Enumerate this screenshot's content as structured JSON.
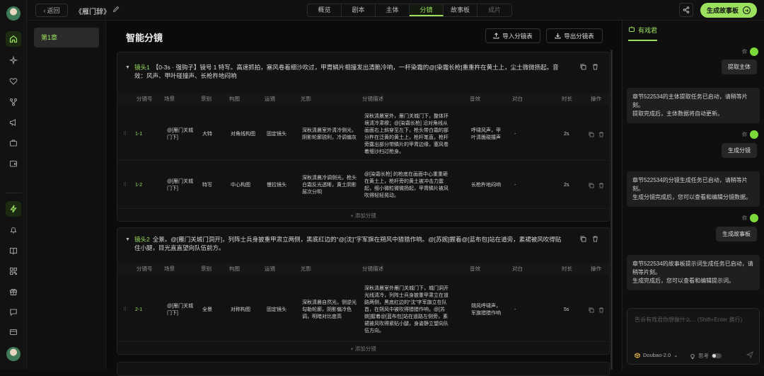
{
  "app": {
    "back_label": "返回",
    "title": "《雁门辞》",
    "tabs": [
      "概览",
      "剧本",
      "主体",
      "分镜",
      "故事板",
      "成片"
    ],
    "active_tab": "分镜",
    "generate_label": "生成故事板",
    "accent": "#9be15d"
  },
  "rail": {
    "icons": [
      "home-icon",
      "sparkles-icon",
      "heart-icon",
      "branch-icon",
      "megaphone-icon",
      "briefcase-icon",
      "wallet-icon",
      "lightning-icon",
      "bell-icon",
      "book-icon",
      "qrcode-icon",
      "gift-icon",
      "chat-icon",
      "card-icon"
    ]
  },
  "sidebar": {
    "chapters": [
      "第1章"
    ]
  },
  "main": {
    "title": "智能分镜",
    "import_label": "导入分镜表",
    "export_label": "导出分镜表",
    "add_label": "+ 添加分镜",
    "columns": [
      "分镜号",
      "场景",
      "景别",
      "构图",
      "运镜",
      "光影",
      "分镜描述",
      "音效",
      "对白",
      "时长",
      "操作"
    ],
    "shots": [
      {
        "id": "镜头1",
        "desc": "【0-3s · 强钩子】镜号 1 特写。高速抓拍，塞风卷着细沙吹过，甲胄鳞片相撞发出清脆冷响，一杆染霜的@[染霜长枪]重重杵在黄土上，尘土微微扬起。音效：风声、甲叶碰撞声、长枪杵地闷响",
        "rows": [
          {
            "no": "1-1",
            "scene": "@[雁门关城门下]",
            "size": "大特",
            "comp": "对角线构图",
            "move": "固定镜头",
            "light": "深秋清晨室外清冷侧光，阴影轮廓锐利，冷调偏灰",
            "desc": "深秋清晨室外，雁门关城门下，整体环境清冷肃穆；@[染霜长枪] 沿对角线从画面右上斜穿至左下，枪头带白霜的部分杵在泛黄的黄土上，枪杆笔直，枪杆旁露出部分带鳞片的甲胄边缘，塞风卷着细沙扫过枪身。",
            "sfx": "呼啸风声，甲叶清脆碰撞声",
            "dialog": "-",
            "dur": "2s"
          },
          {
            "no": "1-2",
            "scene": "@[雁门关城门下]",
            "size": "特写",
            "comp": "中心构图",
            "move": "慢拉镜头",
            "light": "深秋清晨冷调侧光，枪头白霜反光透晰，黄土阴影层次分明",
            "desc": "@[染霜长枪] 的枪底在画面中心重重砸在黄土上，枪杆旁的黄土被冲击力震起，细小微粒微微扬起，甲胄鳞片被风吹得轻轻晃动。",
            "sfx": "长枪杵地闷响",
            "dialog": "-",
            "dur": "2s"
          }
        ]
      },
      {
        "id": "镜头2",
        "desc": "全景。@[雁门关城门洞开]，列阵士兵身披重甲肃立两侧，黑底红边的“@[沈]”字军旗在朔风中猎猎作响。@[苏婉]握着@[蓝布包]站在道旁，素裙被风吹得贴住小腿，目光直直望向队伍前方。",
        "rows": [
          {
            "no": "2-1",
            "scene": "@[雁门关城门下]",
            "size": "全景",
            "comp": "对称构图",
            "move": "固定镜头",
            "light": "深秋清晨自然光，侧逆光勾勒轮廓，阴影偏冷色调，明暗对比度高",
            "desc": "深秋清晨室外雁门关城门下，城门洞开光线清冷，列阵士兵身披重甲肃立在道路两侧，黑底红边的“沈”字军旗立在队首，在朔风中被吹得猎猎作响，@[苏婉]握着@[蓝布包]站在道路左侧旁，素裙被风吹得紧贴小腿，身姿静立望向队伍方向。",
            "sfx": "朔风呼啸声，军旗猎猎作响",
            "dialog": "-",
            "dur": "5s"
          }
        ]
      }
    ]
  },
  "chat": {
    "tab_label": "有戏君",
    "me_label": "你",
    "messages": [
      {
        "role": "user",
        "text": "提取主体"
      },
      {
        "role": "bot",
        "text": "章节522534的主体提取任务已启动，请稍等片刻。\n提取完成后，主体数据将自动更新。"
      },
      {
        "role": "user",
        "text": "生成分镜"
      },
      {
        "role": "bot",
        "text": "章节522534的分镜生成任务已启动，请稍等片刻。\n生成分镜完成后，您可以查看和编辑分镜数据。"
      },
      {
        "role": "user",
        "text": "生成故事板"
      },
      {
        "role": "bot",
        "text": "章节522534的故事板提示词生成任务已启动，请稍等片刻。\n生成完成后，您可以查看和编辑提示词。"
      }
    ],
    "input_placeholder": "告诉有戏君你想做什么... (Shift+Enter 换行)",
    "model": "Doubao-2.0",
    "think_label": "思考"
  }
}
